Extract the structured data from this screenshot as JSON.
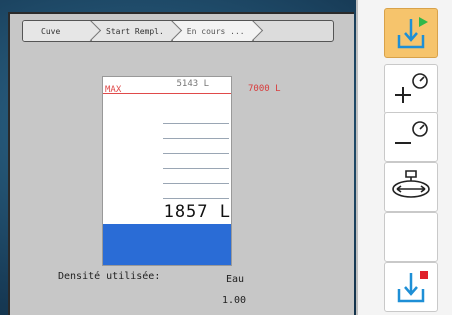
{
  "breadcrumb": [
    {
      "label": "Cuve",
      "active": false
    },
    {
      "label": "Start Rempl.",
      "active": false
    },
    {
      "label": "En cours ...",
      "active": true
    }
  ],
  "tank": {
    "max_label": "MAX",
    "capacity_label": "5143 L",
    "max_value": "7000 L",
    "current_volume": "1857 L",
    "fill_fraction": 0.22,
    "colors": {
      "fill": "#2a6cd6",
      "max_line": "#e04a4a"
    }
  },
  "density": {
    "label": "Densité utilisée:",
    "name": "Eau",
    "value": "1.00"
  },
  "toolbar": {
    "buttons": [
      {
        "icon": "fill-tank-icon",
        "state": "active"
      },
      {
        "icon": "increase-pressure-icon",
        "state": "normal"
      },
      {
        "icon": "decrease-pressure-icon",
        "state": "normal"
      },
      {
        "icon": "valve-icon",
        "state": "normal"
      },
      {
        "icon": "empty-slot",
        "state": "normal"
      },
      {
        "icon": "stop-fill-icon",
        "state": "normal"
      }
    ],
    "colors": {
      "active": "#f6c46c",
      "icon_blue": "#1e8fd6",
      "play_green": "#2fb84a",
      "stop_red": "#e0202a"
    }
  }
}
